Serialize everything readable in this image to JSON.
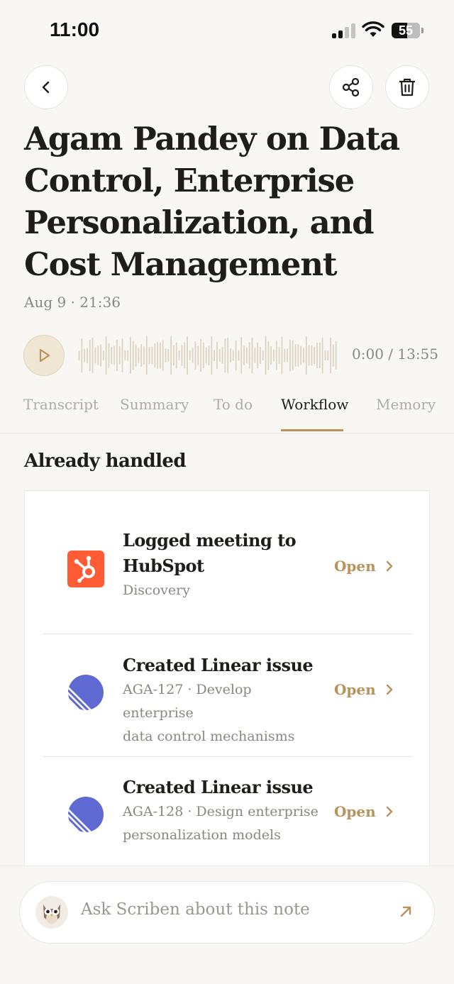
{
  "status_bar": {
    "time": "11:00",
    "battery": "55",
    "battery_fraction": 0.55
  },
  "note": {
    "title": "Agam Pandey on Data Control, Enterprise Personalization, and Cost Management",
    "date": "Aug 9 · 21:36"
  },
  "player": {
    "time_label": "0:00 / 13:55",
    "progress_fraction": 0
  },
  "tabs": [
    {
      "label": "Transcript",
      "active": false
    },
    {
      "label": "Summary",
      "active": false
    },
    {
      "label": "To do",
      "active": false
    },
    {
      "label": "Workflow",
      "active": true
    },
    {
      "label": "Memory",
      "active": false
    }
  ],
  "section": {
    "title": "Already handled"
  },
  "items": [
    {
      "icon": "hubspot-icon",
      "title_lines": [
        "Logged meeting to",
        "HubSpot"
      ],
      "sub_lines": [
        "Discovery"
      ],
      "action": "Open"
    },
    {
      "icon": "linear-icon",
      "title_lines": [
        "Created Linear issue"
      ],
      "sub_lines": [
        "AGA-127 · Develop enterprise",
        "data control mechanisms"
      ],
      "action": "Open"
    },
    {
      "icon": "linear-icon",
      "title_lines": [
        "Created Linear issue"
      ],
      "sub_lines": [
        "AGA-128 · Design enterprise",
        "personalization models"
      ],
      "action": "Open"
    }
  ],
  "ask": {
    "placeholder": "Ask Scriben about this note"
  },
  "colors": {
    "accent": "#b8925a",
    "hubspot": "#ff5c35",
    "linear": "#5e6ad2",
    "background": "#f8f7f4"
  }
}
